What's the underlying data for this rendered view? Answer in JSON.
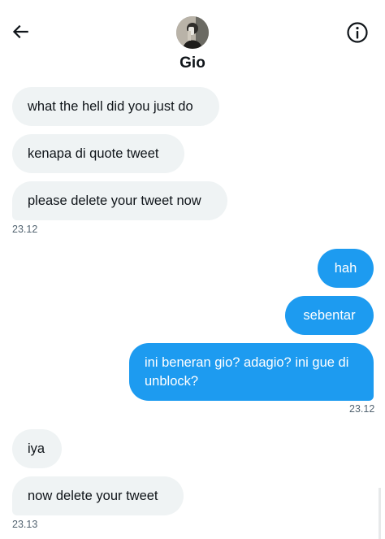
{
  "header": {
    "name": "Gio",
    "back_icon": "arrow-left-icon",
    "info_icon": "info-circle-icon"
  },
  "messages": {
    "m1": "what the hell did you just do",
    "m2": "kenapa di quote tweet",
    "m3": "please delete your tweet now",
    "t1": "23.12",
    "m4": "hah",
    "m5": "sebentar",
    "m6": "ini beneran gio? adagio? ini gue di unblock?",
    "t2": "23.12",
    "m7": "iya",
    "m8": "now delete your tweet",
    "t3": "23.13"
  },
  "colors": {
    "outgoing_bubble": "#1d9bf0",
    "incoming_bubble": "#eff3f4",
    "timestamp": "#536471"
  }
}
